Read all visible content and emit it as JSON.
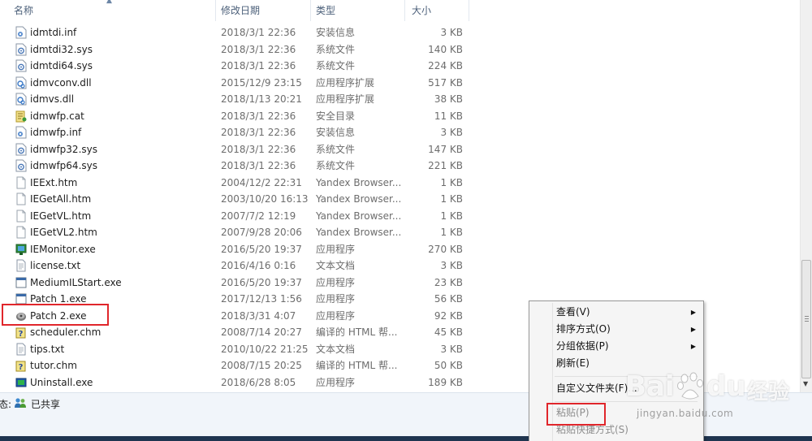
{
  "columns": {
    "name": "名称",
    "date": "修改日期",
    "type": "类型",
    "size": "大小"
  },
  "files": [
    {
      "name": "idmtdi.inf",
      "date": "2018/3/1 22:36",
      "type": "安装信息",
      "size": "3 KB",
      "icon": "settings-file-icon"
    },
    {
      "name": "idmtdi32.sys",
      "date": "2018/3/1 22:36",
      "type": "系统文件",
      "size": "140 KB",
      "icon": "system-file-icon"
    },
    {
      "name": "idmtdi64.sys",
      "date": "2018/3/1 22:36",
      "type": "系统文件",
      "size": "224 KB",
      "icon": "system-file-icon"
    },
    {
      "name": "idmvconv.dll",
      "date": "2015/12/9 23:15",
      "type": "应用程序扩展",
      "size": "517 KB",
      "icon": "dll-file-icon"
    },
    {
      "name": "idmvs.dll",
      "date": "2018/1/13 20:21",
      "type": "应用程序扩展",
      "size": "38 KB",
      "icon": "dll-file-icon"
    },
    {
      "name": "idmwfp.cat",
      "date": "2018/3/1 22:36",
      "type": "安全目录",
      "size": "11 KB",
      "icon": "security-catalog-icon"
    },
    {
      "name": "idmwfp.inf",
      "date": "2018/3/1 22:36",
      "type": "安装信息",
      "size": "3 KB",
      "icon": "settings-file-icon"
    },
    {
      "name": "idmwfp32.sys",
      "date": "2018/3/1 22:36",
      "type": "系统文件",
      "size": "147 KB",
      "icon": "system-file-icon"
    },
    {
      "name": "idmwfp64.sys",
      "date": "2018/3/1 22:36",
      "type": "系统文件",
      "size": "221 KB",
      "icon": "system-file-icon"
    },
    {
      "name": "IEExt.htm",
      "date": "2004/12/2 22:31",
      "type": "Yandex Browser...",
      "size": "1 KB",
      "icon": "html-file-icon"
    },
    {
      "name": "IEGetAll.htm",
      "date": "2003/10/20 16:13",
      "type": "Yandex Browser...",
      "size": "1 KB",
      "icon": "html-file-icon"
    },
    {
      "name": "IEGetVL.htm",
      "date": "2007/7/2 12:19",
      "type": "Yandex Browser...",
      "size": "1 KB",
      "icon": "html-file-icon"
    },
    {
      "name": "IEGetVL2.htm",
      "date": "2007/9/28 20:06",
      "type": "Yandex Browser...",
      "size": "1 KB",
      "icon": "html-file-icon"
    },
    {
      "name": "IEMonitor.exe",
      "date": "2016/5/20 19:37",
      "type": "应用程序",
      "size": "270 KB",
      "icon": "monitor-app-icon"
    },
    {
      "name": "license.txt",
      "date": "2016/4/16 0:16",
      "type": "文本文档",
      "size": "3 KB",
      "icon": "text-file-icon"
    },
    {
      "name": "MediumILStart.exe",
      "date": "2016/5/20 19:37",
      "type": "应用程序",
      "size": "23 KB",
      "icon": "exe-window-icon"
    },
    {
      "name": "Patch 1.exe",
      "date": "2017/12/13 1:56",
      "type": "应用程序",
      "size": "56 KB",
      "icon": "exe-window-icon"
    },
    {
      "name": "Patch 2.exe",
      "date": "2018/3/31 4:07",
      "type": "应用程序",
      "size": "92 KB",
      "icon": "patch-gear-icon"
    },
    {
      "name": "scheduler.chm",
      "date": "2008/7/14 20:27",
      "type": "编译的 HTML 帮...",
      "size": "45 KB",
      "icon": "chm-help-icon"
    },
    {
      "name": "tips.txt",
      "date": "2010/10/22 21:25",
      "type": "文本文档",
      "size": "3 KB",
      "icon": "text-file-icon"
    },
    {
      "name": "tutor.chm",
      "date": "2008/7/15 20:25",
      "type": "编译的 HTML 帮...",
      "size": "50 KB",
      "icon": "chm-help-icon"
    },
    {
      "name": "Uninstall.exe",
      "date": "2018/6/28 8:05",
      "type": "应用程序",
      "size": "189 KB",
      "icon": "uninstall-icon"
    }
  ],
  "status": {
    "label": "态:",
    "shared": "已共享"
  },
  "context_menu": {
    "items": [
      {
        "label": "查看(V)",
        "submenu": true,
        "enabled": true
      },
      {
        "label": "排序方式(O)",
        "submenu": true,
        "enabled": true
      },
      {
        "label": "分组依据(P)",
        "submenu": true,
        "enabled": true
      },
      {
        "label": "刷新(E)",
        "submenu": false,
        "enabled": true
      },
      {
        "label": "自定义文件夹(F)...",
        "submenu": false,
        "enabled": true
      },
      {
        "label": "粘贴(P)",
        "submenu": false,
        "enabled": false
      },
      {
        "label": "粘贴快捷方式(S)",
        "submenu": false,
        "enabled": false
      }
    ]
  },
  "watermark": {
    "brand": "Bai",
    "brand_end": "du",
    "cn": "经验",
    "url": "jingyan.baidu.com"
  },
  "colors": {
    "highlight": "#e0262b",
    "header_text": "#4c607a"
  }
}
